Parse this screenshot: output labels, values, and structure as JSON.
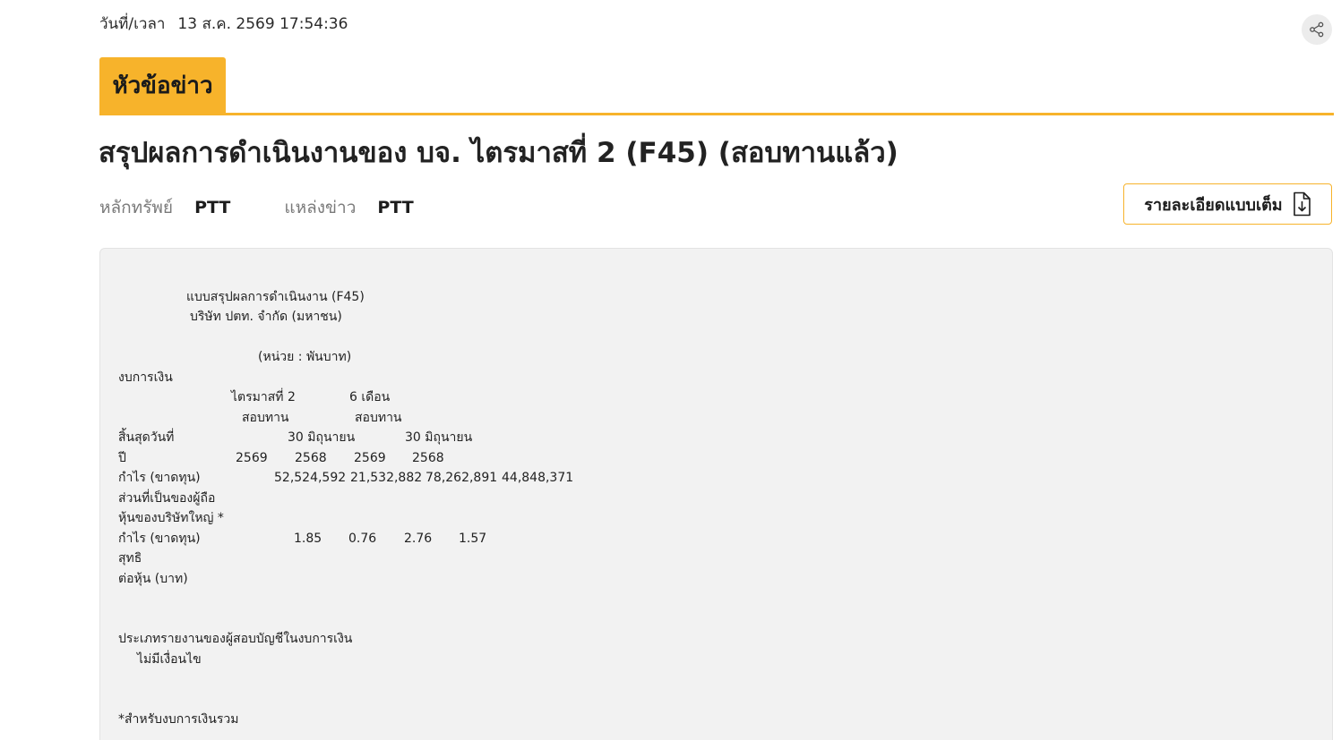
{
  "header": {
    "datetime_label": "วันที่/เวลา",
    "datetime_value": "13 ส.ค. 2569 17:54:36"
  },
  "share": {
    "icon": "share-icon"
  },
  "section_tab": {
    "label": "หัวข้อข่าว",
    "color": "#f7b32b"
  },
  "headline": "สรุปผลการดำเนินงานของ บจ. ไตรมาสที่ 2 (F45) (สอบทานแล้ว)",
  "meta": {
    "security_label": "หลักทรัพย์",
    "security_value": "PTT",
    "source_label": "แหล่งข่าว",
    "source_value": "PTT"
  },
  "full_detail_button": {
    "label": "รายละเอียดแบบเต็ม",
    "icon": "document-download-icon"
  },
  "report": {
    "form_title": "แบบสรุปผลการดำเนินงาน (F45)",
    "company": "บริษัท ปตท. จำกัด (มหาชน)",
    "unit": "(หน่วย : พันบาท)",
    "statement_label": "งบการเงิน",
    "period_q2": "ไตรมาสที่ 2",
    "period_6m": "6 เดือน",
    "audit_q2": "สอบทาน",
    "audit_6m": "สอบทาน",
    "period_end_label": "สิ้นสุดวันที่",
    "period_end_q2": "30 มิถุนายน",
    "period_end_6m": "30 มิถุนายน",
    "year_label": "ปี",
    "years": [
      "2569",
      "2568",
      "2569",
      "2568"
    ],
    "profit_label": "กำไร (ขาดทุน)",
    "profit_values": [
      "52,524,592",
      "21,532,882",
      "78,262,891",
      "44,848,371"
    ],
    "profit_sub1": "ส่วนที่เป็นของผู้ถือ",
    "profit_sub2": "หุ้นของบริษัทใหญ่ *",
    "eps_label": "กำไร (ขาดทุน)",
    "eps_values": [
      "1.85",
      "0.76",
      "2.76",
      "1.57"
    ],
    "eps_sub1": "สุทธิ",
    "eps_sub2": "ต่อหุ้น (บาท)",
    "auditor_report_label": "ประเภทรายงานของผู้สอบบัญชีในงบการเงิน",
    "auditor_report_value": "ไม่มีเงื่อนไข",
    "footnote": "*สำหรับงบการเงินรวม"
  }
}
